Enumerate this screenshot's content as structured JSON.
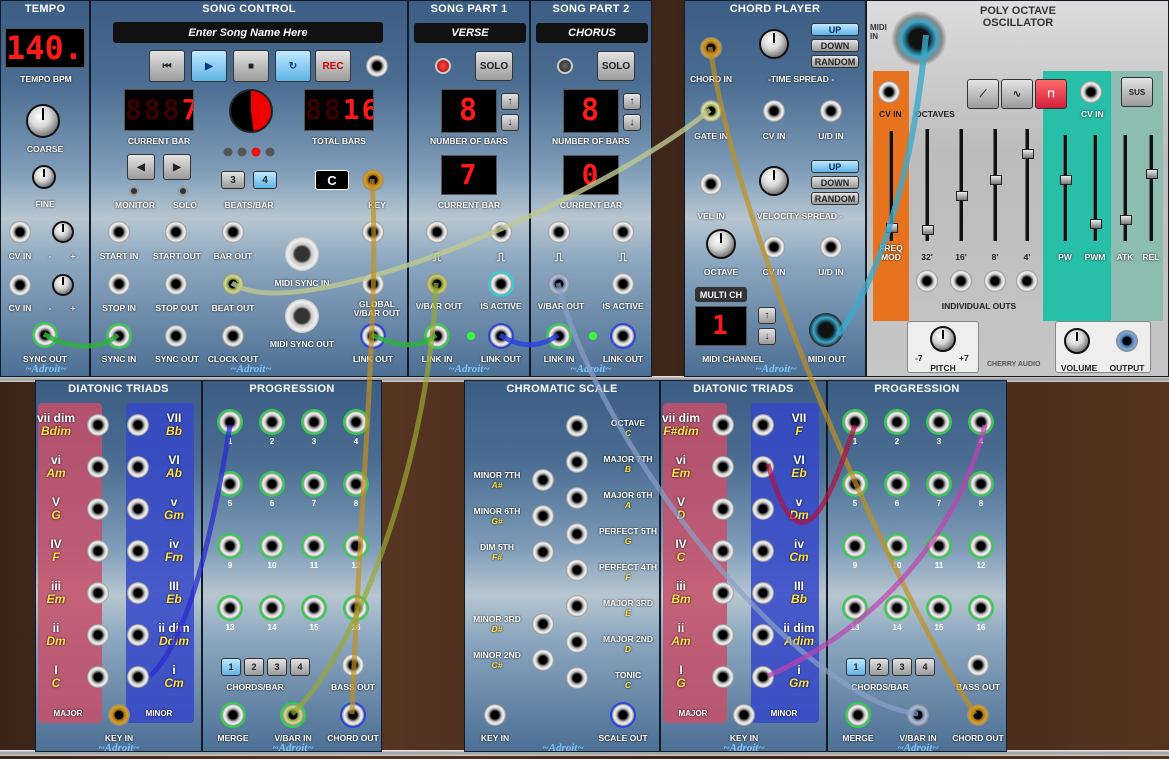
{
  "tempo": {
    "title": "TEMPO",
    "display": "140.0",
    "bpm_label": "TEMPO BPM",
    "coarse": "COARSE",
    "fine": "FINE",
    "cv_in": "CV IN",
    "minus": "-",
    "plus": "+",
    "sync_out": "SYNC OUT",
    "brand": "~Adroit~"
  },
  "song_control": {
    "title": "SONG CONTROL",
    "song_name_placeholder": "Enter Song Name Here",
    "rec": "REC",
    "current_bar": "7",
    "current_bar_label": "CURRENT BAR",
    "total_bars": "16",
    "total_bars_label": "TOTAL BARS",
    "monitor": "MONITOR",
    "solo": "SOLO",
    "beats_3": "3",
    "beats_4": "4",
    "beats_label": "BEATS/BAR",
    "key_value": "C",
    "key_label": "KEY",
    "start_in": "START IN",
    "start_out": "START OUT",
    "bar_out": "BAR OUT",
    "stop_in": "STOP IN",
    "stop_out": "STOP OUT",
    "beat_out": "BEAT OUT",
    "midi_sync_in": "MIDI SYNC IN",
    "midi_sync_out": "MIDI SYNC OUT",
    "sync_in": "SYNC IN",
    "sync_out": "SYNC OUT",
    "clock_out": "CLOCK OUT",
    "global_vbar_out": "GLOBAL V/BAR OUT",
    "link_out": "LINK OUT",
    "brand": "~Adroit~"
  },
  "song_part_1": {
    "title": "SONG PART 1",
    "name": "VERSE",
    "solo": "SOLO",
    "bars": "8",
    "bars_label": "NUMBER OF BARS",
    "current": "7",
    "current_label": "CURRENT BAR",
    "vbar_out": "V/BAR OUT",
    "is_active": "IS ACTIVE",
    "link_in": "LINK IN",
    "link_out": "LINK OUT",
    "brand": "~Adroit~"
  },
  "song_part_2": {
    "title": "SONG PART 2",
    "name": "CHORUS",
    "solo": "SOLO",
    "bars": "8",
    "bars_label": "NUMBER OF BARS",
    "current": "0",
    "current_label": "CURRENT BAR",
    "vbar_out": "V/BAR OUT",
    "is_active": "IS ACTIVE",
    "link_in": "LINK IN",
    "link_out": "LINK OUT",
    "brand": "~Adroit~"
  },
  "chord_player": {
    "title": "CHORD PLAYER",
    "chord_in": "CHORD IN",
    "gate_in": "GATE IN",
    "time_spread": "-TIME SPREAD -",
    "up": "UP",
    "down": "DOWN",
    "random": "RANDOM",
    "cv_in": "CV IN",
    "ud_in": "U/D IN",
    "vel_in": "VEL IN",
    "velocity_spread": "- VELOCITY SPREAD -",
    "octave": "OCTAVE",
    "multi_ch": "MULTI CH",
    "midi_channel": "1",
    "midi_channel_label": "MIDI CHANNEL",
    "midi_out": "MIDI OUT",
    "brand": "~Adroit~"
  },
  "poly_osc": {
    "title": "POLY OCTAVE OSCILLATOR",
    "midi_in": "MIDI IN",
    "cv_in": "CV IN",
    "octaves": "OCTAVES",
    "freq_mod": "FREQ MOD",
    "o32": "32'",
    "o16": "16'",
    "o8": "8'",
    "o4": "4'",
    "individual_outs": "INDIVIDUAL OUTS",
    "pw": "PW",
    "pwm": "PWM",
    "atk": "ATK",
    "rel": "REL",
    "sus": "SUS",
    "pitch": "PITCH",
    "pitch_min": "-7",
    "pitch_max": "+7",
    "volume": "VOLUME",
    "output": "OUTPUT",
    "maker": "CHERRY AUDIO",
    "orange": "#e8731f",
    "teal": "#27bfa8"
  },
  "diatonic_1": {
    "title": "DIATONIC TRIADS",
    "major_label": "MAJOR",
    "minor_label": "MINOR",
    "key_in": "KEY IN",
    "brand": "~Adroit~",
    "major": [
      {
        "d": "vii dim",
        "c": "Bdim"
      },
      {
        "d": "vi",
        "c": "Am"
      },
      {
        "d": "V",
        "c": "G"
      },
      {
        "d": "IV",
        "c": "F"
      },
      {
        "d": "iii",
        "c": "Em"
      },
      {
        "d": "ii",
        "c": "Dm"
      },
      {
        "d": "I",
        "c": "C"
      }
    ],
    "minor": [
      {
        "d": "VII",
        "c": "Bb"
      },
      {
        "d": "VI",
        "c": "Ab"
      },
      {
        "d": "v",
        "c": "Gm"
      },
      {
        "d": "iv",
        "c": "Fm"
      },
      {
        "d": "III",
        "c": "Eb"
      },
      {
        "d": "ii dim",
        "c": "Ddim"
      },
      {
        "d": "i",
        "c": "Cm"
      }
    ]
  },
  "progression_1": {
    "title": "PROGRESSION",
    "chords_bar": "CHORDS/BAR",
    "bass_out": "BASS OUT",
    "merge": "MERGE",
    "vbar_in": "V/BAR IN",
    "chord_out": "CHORD OUT",
    "brand": "~Adroit~",
    "steps": [
      "1",
      "2",
      "3",
      "4",
      "5",
      "6",
      "7",
      "8",
      "9",
      "10",
      "11",
      "12",
      "13",
      "14",
      "15",
      "16"
    ],
    "cb": [
      "1",
      "2",
      "3",
      "4"
    ]
  },
  "chromatic": {
    "title": "CHROMATIC SCALE",
    "key_in": "KEY IN",
    "scale_out": "SCALE OUT",
    "brand": "~Adroit~",
    "right": [
      {
        "n": "OCTAVE",
        "k": "C"
      },
      {
        "n": "MAJOR 7TH",
        "k": "B"
      },
      {
        "n": "MAJOR 6TH",
        "k": "A"
      },
      {
        "n": "PERFECT 5TH",
        "k": "G"
      },
      {
        "n": "PERFECT 4TH",
        "k": "F"
      },
      {
        "n": "MAJOR 3RD",
        "k": "E"
      },
      {
        "n": "MAJOR 2ND",
        "k": "D"
      },
      {
        "n": "TONIC",
        "k": "C"
      }
    ],
    "left": [
      {
        "n": "MINOR 7TH",
        "k": "A#"
      },
      {
        "n": "MINOR 6TH",
        "k": "G#"
      },
      {
        "n": "DIM 5TH",
        "k": "F#"
      },
      {
        "n": "MINOR 3RD",
        "k": "D#"
      },
      {
        "n": "MINOR 2ND",
        "k": "C#"
      }
    ]
  },
  "diatonic_2": {
    "title": "DIATONIC TRIADS",
    "major_label": "MAJOR",
    "minor_label": "MINOR",
    "key_in": "KEY IN",
    "brand": "~Adroit~",
    "major": [
      {
        "d": "vii dim",
        "c": "F#dim"
      },
      {
        "d": "vi",
        "c": "Em"
      },
      {
        "d": "V",
        "c": "D"
      },
      {
        "d": "IV",
        "c": "C"
      },
      {
        "d": "iii",
        "c": "Bm"
      },
      {
        "d": "ii",
        "c": "Am"
      },
      {
        "d": "I",
        "c": "G"
      }
    ],
    "minor": [
      {
        "d": "VII",
        "c": "F"
      },
      {
        "d": "VI",
        "c": "Eb"
      },
      {
        "d": "v",
        "c": "Dm"
      },
      {
        "d": "iv",
        "c": "Cm"
      },
      {
        "d": "III",
        "c": "Bb"
      },
      {
        "d": "ii dim",
        "c": "Adim"
      },
      {
        "d": "i",
        "c": "Gm"
      }
    ]
  },
  "progression_2": {
    "title": "PROGRESSION",
    "chords_bar": "CHORDS/BAR",
    "bass_out": "BASS OUT",
    "merge": "MERGE",
    "vbar_in": "V/BAR IN",
    "chord_out": "CHORD OUT",
    "brand": "~Adroit~",
    "steps": [
      "1",
      "2",
      "3",
      "4",
      "5",
      "6",
      "7",
      "8",
      "9",
      "10",
      "11",
      "12",
      "13",
      "14",
      "15",
      "16"
    ],
    "cb": [
      "1",
      "2",
      "3",
      "4"
    ]
  }
}
